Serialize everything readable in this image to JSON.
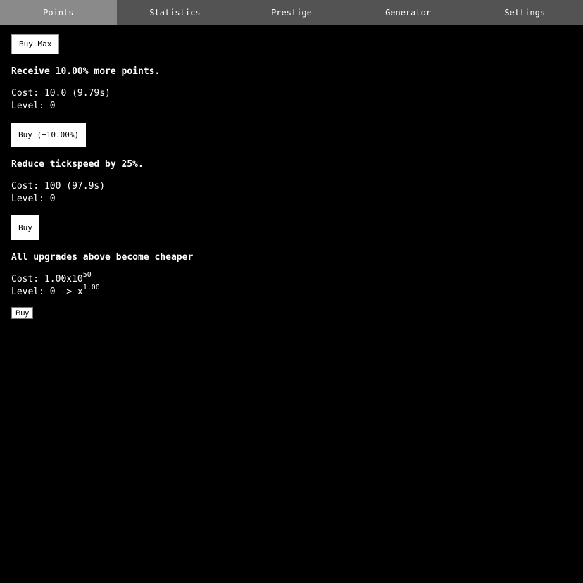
{
  "tabs": [
    {
      "label": "Points",
      "active": true
    },
    {
      "label": "Statistics",
      "active": false
    },
    {
      "label": "Prestige",
      "active": false
    },
    {
      "label": "Generator",
      "active": false
    },
    {
      "label": "Settings",
      "active": false
    }
  ],
  "buy_max_label": "Buy Max",
  "upgrades": [
    {
      "title": "Receive 10.00% more points.",
      "cost": "Cost: 10.0 (9.79s)",
      "level": "Level: 0",
      "button": "Buy (+10.00%)"
    },
    {
      "title": "Reduce tickspeed by 25%.",
      "cost": "Cost: 100 (97.9s)",
      "level": "Level: 0",
      "button": "Buy"
    },
    {
      "title": "All upgrades above become cheaper",
      "cost_prefix": "Cost: 1.00x10",
      "cost_exp": "50",
      "level_prefix": "Level: 0 -> x",
      "level_exp": "1.00",
      "button": "Buy"
    }
  ],
  "colors": {
    "background": "#000000",
    "tabbar": "#535353",
    "tab_active": "#8a8a8a",
    "text": "#ffffff",
    "button_bg": "#ffffff",
    "button_text": "#000000"
  }
}
